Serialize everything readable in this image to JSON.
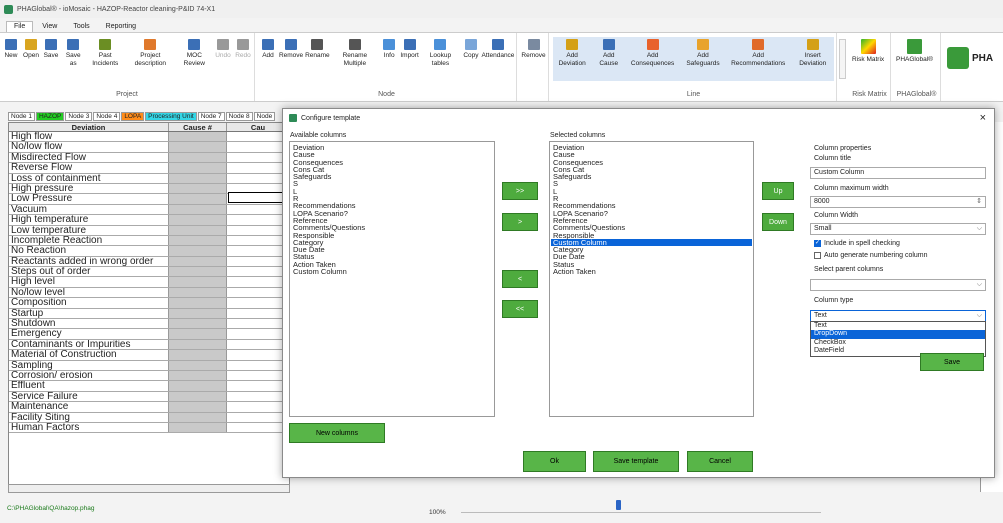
{
  "window": {
    "title": "PHAGlobal® - ioMosaic - HAZOP-Reactor cleaning-P&ID 74-X1"
  },
  "menu": [
    "File",
    "View",
    "Tools",
    "Reporting"
  ],
  "ribbon": {
    "project": {
      "label": "Project",
      "buttons": [
        {
          "label": "New",
          "icon": "new-icon"
        },
        {
          "label": "Open",
          "icon": "open-icon"
        },
        {
          "label": "Save",
          "icon": "save-icon"
        },
        {
          "label": "Save as",
          "icon": "save-as-icon"
        },
        {
          "label": "Past Incidents",
          "icon": "past-incidents-icon"
        },
        {
          "label": "Project description",
          "icon": "project-description-icon"
        },
        {
          "label": "MOC Review",
          "icon": "moc-review-icon"
        },
        {
          "label": "Undo",
          "icon": "undo-icon",
          "disabled": true
        },
        {
          "label": "Redo",
          "icon": "redo-icon",
          "disabled": true
        }
      ]
    },
    "node": {
      "label": "Node",
      "buttons": [
        {
          "label": "Add",
          "icon": "add-icon"
        },
        {
          "label": "Remove",
          "icon": "remove-icon"
        },
        {
          "label": "Rename",
          "icon": "rename-icon"
        },
        {
          "label": "Rename Multiple",
          "icon": "rename-multiple-icon"
        },
        {
          "label": "Info",
          "icon": "info-icon"
        },
        {
          "label": "Import",
          "icon": "import-icon"
        },
        {
          "label": "Lookup tables",
          "icon": "lookup-tables-icon"
        },
        {
          "label": "Copy",
          "icon": "copy-icon"
        },
        {
          "label": "Attendance",
          "icon": "attendance-icon"
        }
      ]
    },
    "line": {
      "label": "Line",
      "remove": {
        "label": "Remove",
        "icon": "remove-line-icon"
      },
      "buttons": [
        {
          "label": "Add Deviation",
          "icon": "add-deviation-icon"
        },
        {
          "label": "Add Cause",
          "icon": "add-cause-icon"
        },
        {
          "label": "Add Consequences",
          "icon": "add-consequences-icon"
        },
        {
          "label": "Add Safeguards",
          "icon": "add-safeguards-icon"
        },
        {
          "label": "Add Recommendations",
          "icon": "add-recommendations-icon"
        },
        {
          "label": "Insert Deviation",
          "icon": "insert-deviation-icon"
        }
      ]
    },
    "risk": {
      "label": "Risk Matrix",
      "button": "Risk Matrix"
    },
    "phaglobal": {
      "label": "PHAGlobal®",
      "button": "PHAGlobal®"
    },
    "brand": "PHA"
  },
  "sheet_tabs": [
    {
      "label": "Node 1",
      "color": "#ffffff"
    },
    {
      "label": "HAZOP",
      "color": "#22cc22"
    },
    {
      "label": "Node 3",
      "color": "#ffffff"
    },
    {
      "label": "Node 4",
      "color": "#ffffff"
    },
    {
      "label": "LOPA",
      "color": "#ff8c1a"
    },
    {
      "label": "Processing Unit",
      "color": "#33d6e6"
    },
    {
      "label": "Node 7",
      "color": "#ffffff"
    },
    {
      "label": "Node 8",
      "color": "#ffffff"
    },
    {
      "label": "Node",
      "color": "#ffffff"
    }
  ],
  "grid": {
    "headers": [
      "Deviation",
      "Cause #",
      "Cau"
    ],
    "rows": [
      "High flow",
      "No/low flow",
      "Misdirected Flow",
      "Reverse Flow",
      "Loss of containment",
      "High pressure",
      "Low Pressure",
      "Vacuum",
      "High temperature",
      "Low temperature",
      "Incomplete Reaction",
      "No Reaction",
      "Reactants added in wrong order",
      "Steps out of order",
      "High level",
      "No/low level",
      "Composition",
      "Startup",
      "Shutdown",
      "Emergency",
      "Contaminants or Impurities",
      "Material of Construction",
      "Sampling",
      "Corrosion/ erosion",
      "Effluent",
      "Service Failure",
      "Maintenance",
      "Facility Siting",
      "Human Factors"
    ]
  },
  "status": {
    "path": "C:\\PHAGlobal\\QA\\hazop.phag",
    "zoom": "100%"
  },
  "dialog": {
    "title": "Configure template",
    "available_label": "Available columns",
    "available": [
      "Deviation",
      "Cause",
      "Consequences",
      "Cons Cat",
      "Safeguards",
      "S",
      "L",
      "R",
      "Recommendations",
      "LOPA Scenario?",
      "Reference",
      "Comments/Questions",
      "Responsible",
      "Category",
      "Due Date",
      "Status",
      "Action Taken",
      "Custom Column"
    ],
    "selected_label": "Selected columns",
    "selected": [
      "Deviation",
      "Cause",
      "Consequences",
      "Cons Cat",
      "Safeguards",
      "S",
      "L",
      "R",
      "Recommendations",
      "LOPA Scenario?",
      "Reference",
      "Comments/Questions",
      "Responsible",
      "Custom Column",
      "Category",
      "Due Date",
      "Status",
      "Action Taken"
    ],
    "selected_item": "Custom Column",
    "move_buttons": [
      ">>",
      ">",
      "<",
      "<<"
    ],
    "up": "Up",
    "down": "Down",
    "new_columns": "New columns",
    "ok": "Ok",
    "save_template": "Save template",
    "cancel": "Cancel",
    "close": "×",
    "props": {
      "heading": "Column properties",
      "title_label": "Column title",
      "title_value": "Custom Column",
      "max_width_label": "Column maximum width",
      "max_width_value": "8000",
      "width_label": "Column Width",
      "width_value": "Small",
      "spell_label": "Include in spell checking",
      "spell_checked": true,
      "autonum_label": "Auto generate numbering column",
      "autonum_checked": false,
      "parent_label": "Select parent columns",
      "parent_value": "",
      "type_label": "Column type",
      "type_value": "Text",
      "type_options": [
        "Text",
        "DropDown",
        "CheckBox",
        "DateField"
      ],
      "type_highlight": "DropDown",
      "save": "Save"
    }
  }
}
